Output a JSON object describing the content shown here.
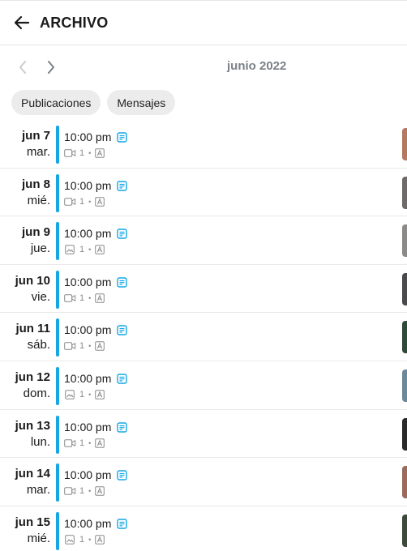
{
  "header": {
    "title": "ARCHIVO",
    "back_icon": "arrow-left-icon"
  },
  "month_nav": {
    "label": "junio 2022",
    "prev_icon": "chevron-left-icon",
    "next_icon": "chevron-right-icon"
  },
  "filters": [
    {
      "label": "Publicaciones"
    },
    {
      "label": "Mensajes"
    }
  ],
  "colors": {
    "accent": "#16a6e3",
    "note_icon": "#16a6e3",
    "chip_bg": "#ececec",
    "muted": "#8a8a8a"
  },
  "entries": [
    {
      "day": "jun 7",
      "weekday": "mar.",
      "time": "10:00 pm",
      "media": "video",
      "count": "1",
      "thumb": "#b27a5e"
    },
    {
      "day": "jun 8",
      "weekday": "mié.",
      "time": "10:00 pm",
      "media": "video",
      "count": "1",
      "thumb": "#6f6a68"
    },
    {
      "day": "jun 9",
      "weekday": "jue.",
      "time": "10:00 pm",
      "media": "image",
      "count": "1",
      "thumb": "#8c8a88"
    },
    {
      "day": "jun 10",
      "weekday": "vie.",
      "time": "10:00 pm",
      "media": "video",
      "count": "1",
      "thumb": "#4a4a4c"
    },
    {
      "day": "jun 11",
      "weekday": "sáb.",
      "time": "10:00 pm",
      "media": "video",
      "count": "1",
      "thumb": "#2f4a38"
    },
    {
      "day": "jun 12",
      "weekday": "dom.",
      "time": "10:00 pm",
      "media": "image",
      "count": "1",
      "thumb": "#6a8a9a"
    },
    {
      "day": "jun 13",
      "weekday": "lun.",
      "time": "10:00 pm",
      "media": "video",
      "count": "1",
      "thumb": "#2a2a2a"
    },
    {
      "day": "jun 14",
      "weekday": "mar.",
      "time": "10:00 pm",
      "media": "video",
      "count": "1",
      "thumb": "#9a6a5a"
    },
    {
      "day": "jun 15",
      "weekday": "mié.",
      "time": "10:00 pm",
      "media": "image",
      "count": "1",
      "thumb": "#3c4a3a"
    }
  ]
}
